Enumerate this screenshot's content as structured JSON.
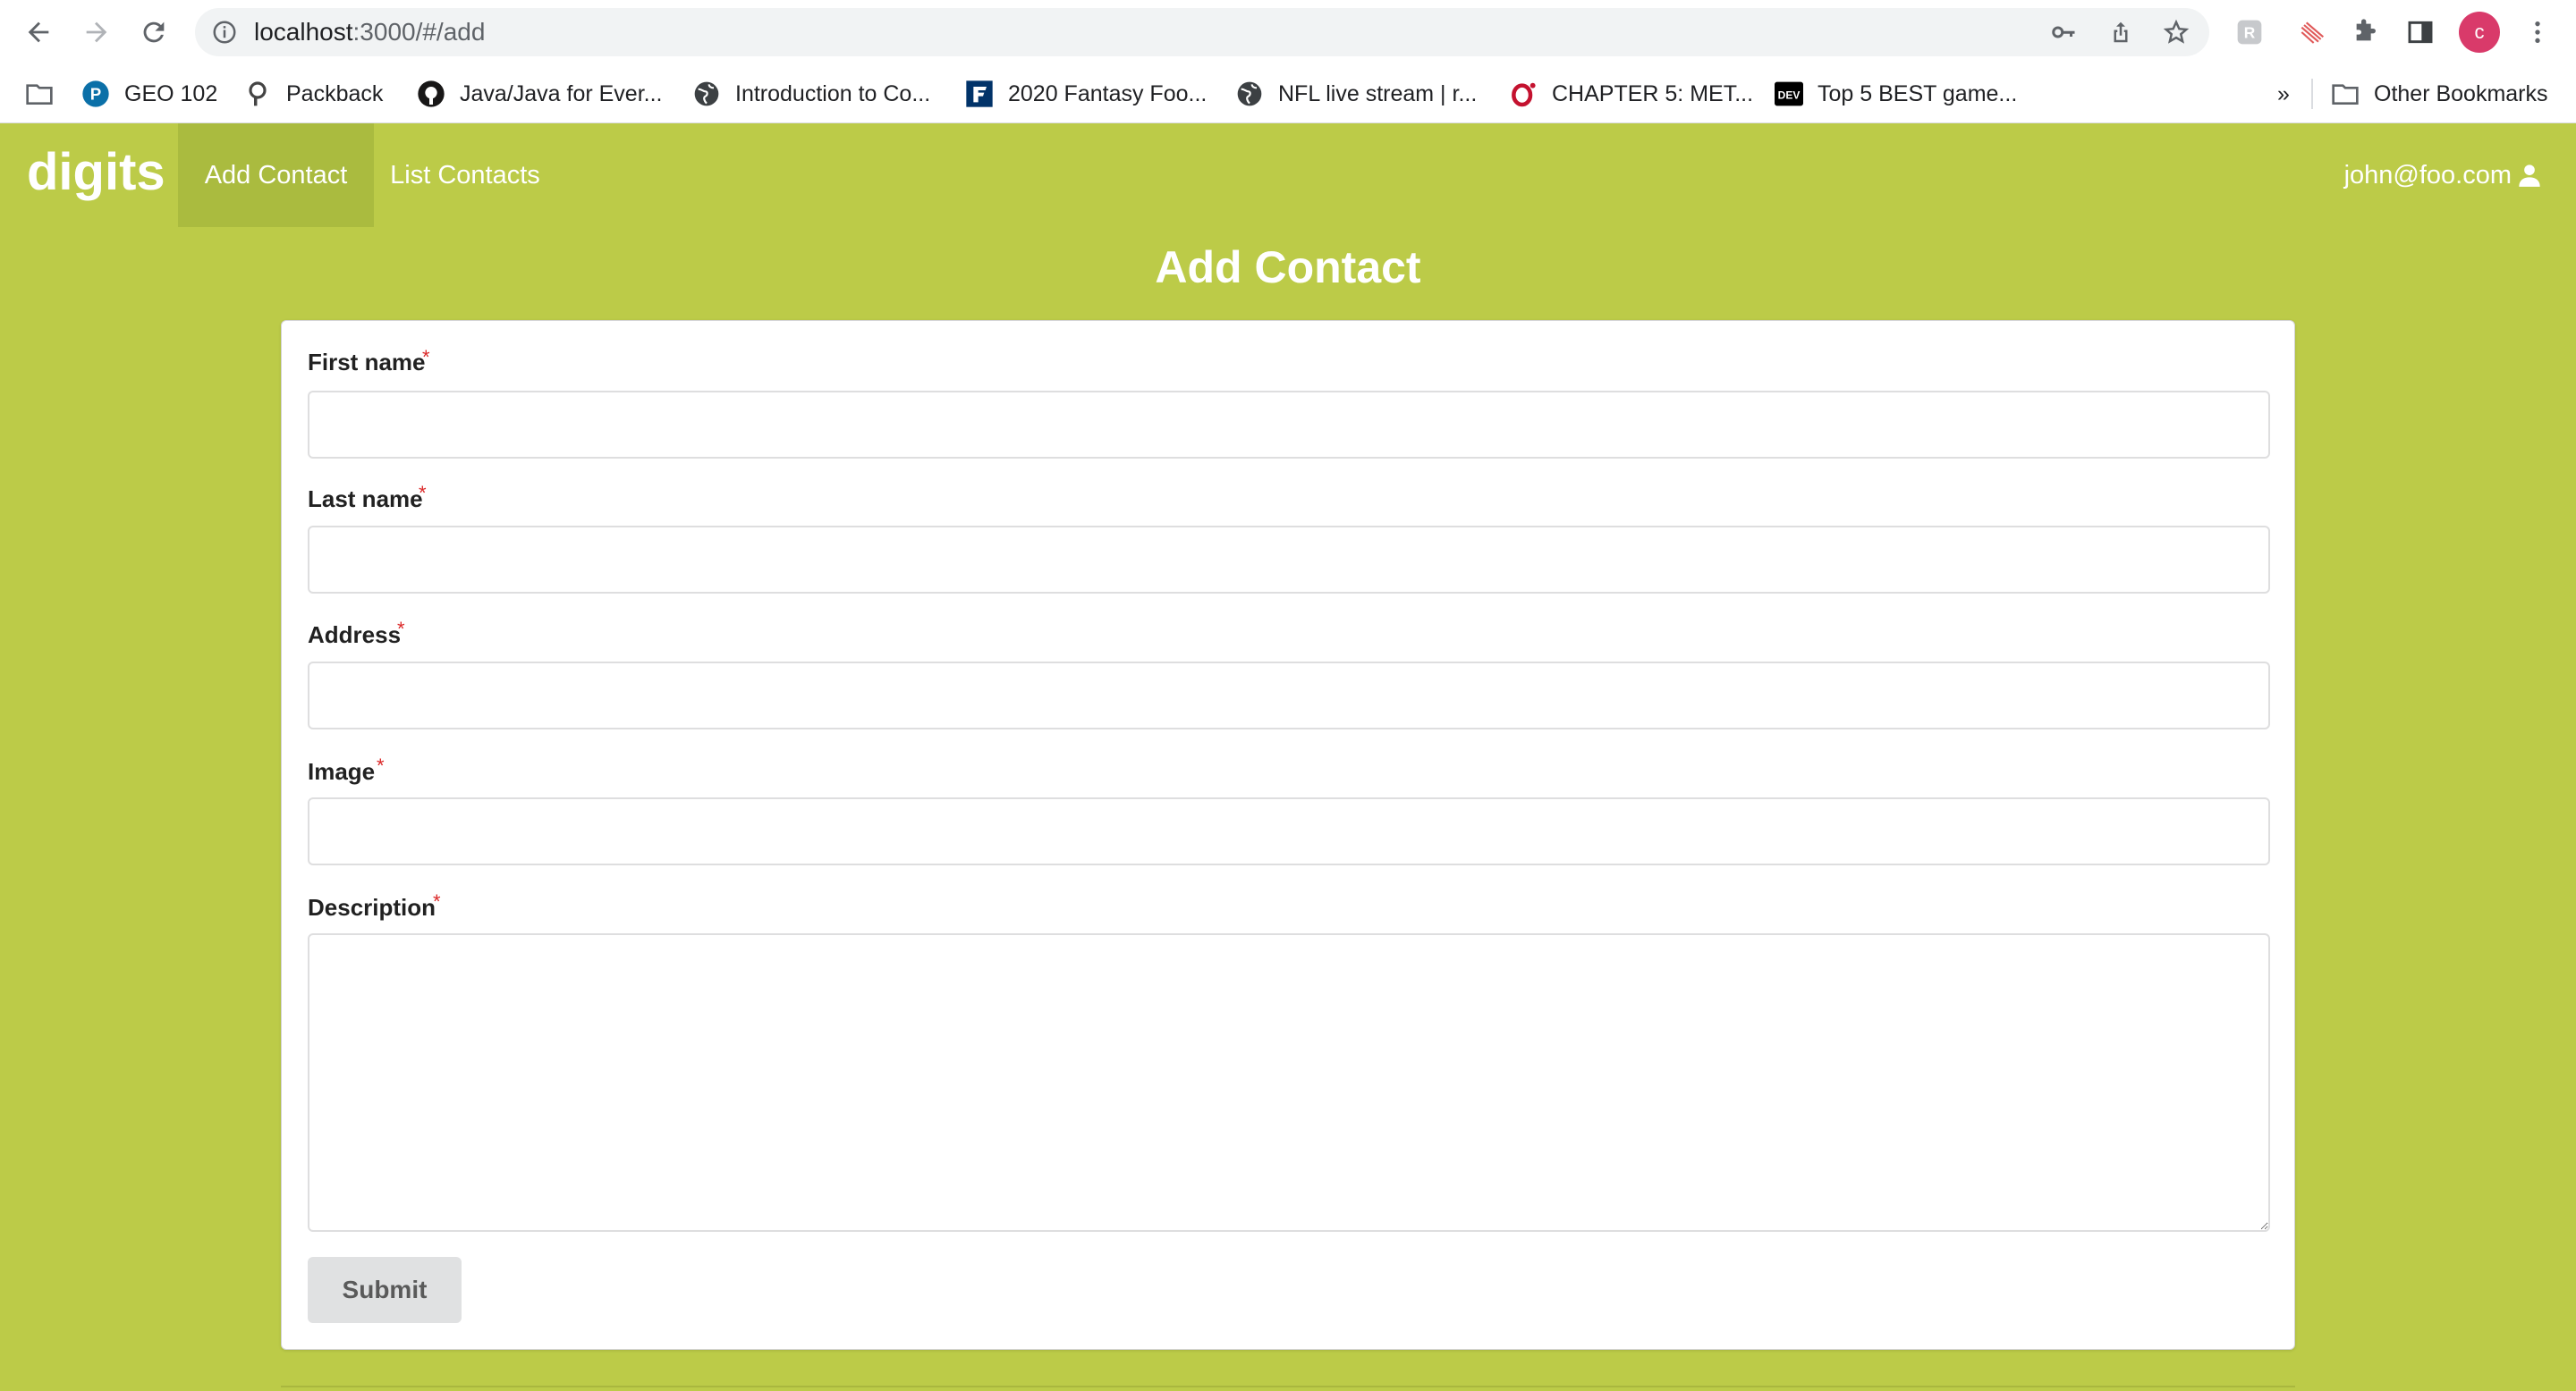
{
  "browser": {
    "url_host": "localhost",
    "url_path": ":3000/#/add",
    "profile_initial": "c",
    "bookmarks": [
      {
        "label": "GEO 102",
        "icon": "pearson-icon"
      },
      {
        "label": "Packback",
        "icon": "packback-icon"
      },
      {
        "label": "Java/Java for Ever...",
        "icon": "github-icon"
      },
      {
        "label": "Introduction to Co...",
        "icon": "globe-icon"
      },
      {
        "label": "2020 Fantasy Foo...",
        "icon": "fantasy-football-icon"
      },
      {
        "label": "NFL live stream | r...",
        "icon": "globe-icon"
      },
      {
        "label": "CHAPTER 5: MET...",
        "icon": "opera-icon"
      },
      {
        "label": "Top 5 BEST game...",
        "icon": "dev-icon"
      }
    ],
    "overflow_label": "»",
    "other_bookmarks": "Other Bookmarks"
  },
  "app": {
    "brand": "digits",
    "nav": {
      "add": "Add Contact",
      "list": "List Contacts"
    },
    "user": "john@foo.com",
    "page_title": "Add Contact"
  },
  "form": {
    "fields": [
      {
        "label": "First name",
        "required": "*",
        "value": ""
      },
      {
        "label": "Last name",
        "required": "*",
        "value": ""
      },
      {
        "label": "Address",
        "required": "*",
        "value": ""
      },
      {
        "label": "Image",
        "required": "*",
        "value": ""
      },
      {
        "label": "Description",
        "required": "*",
        "value": ""
      }
    ],
    "submit_label": "Submit"
  },
  "colors": {
    "page_background": "#bccb48",
    "active_nav": "#aabb3f",
    "required_marker": "#db2828",
    "profile_avatar": "#d93a6a"
  }
}
